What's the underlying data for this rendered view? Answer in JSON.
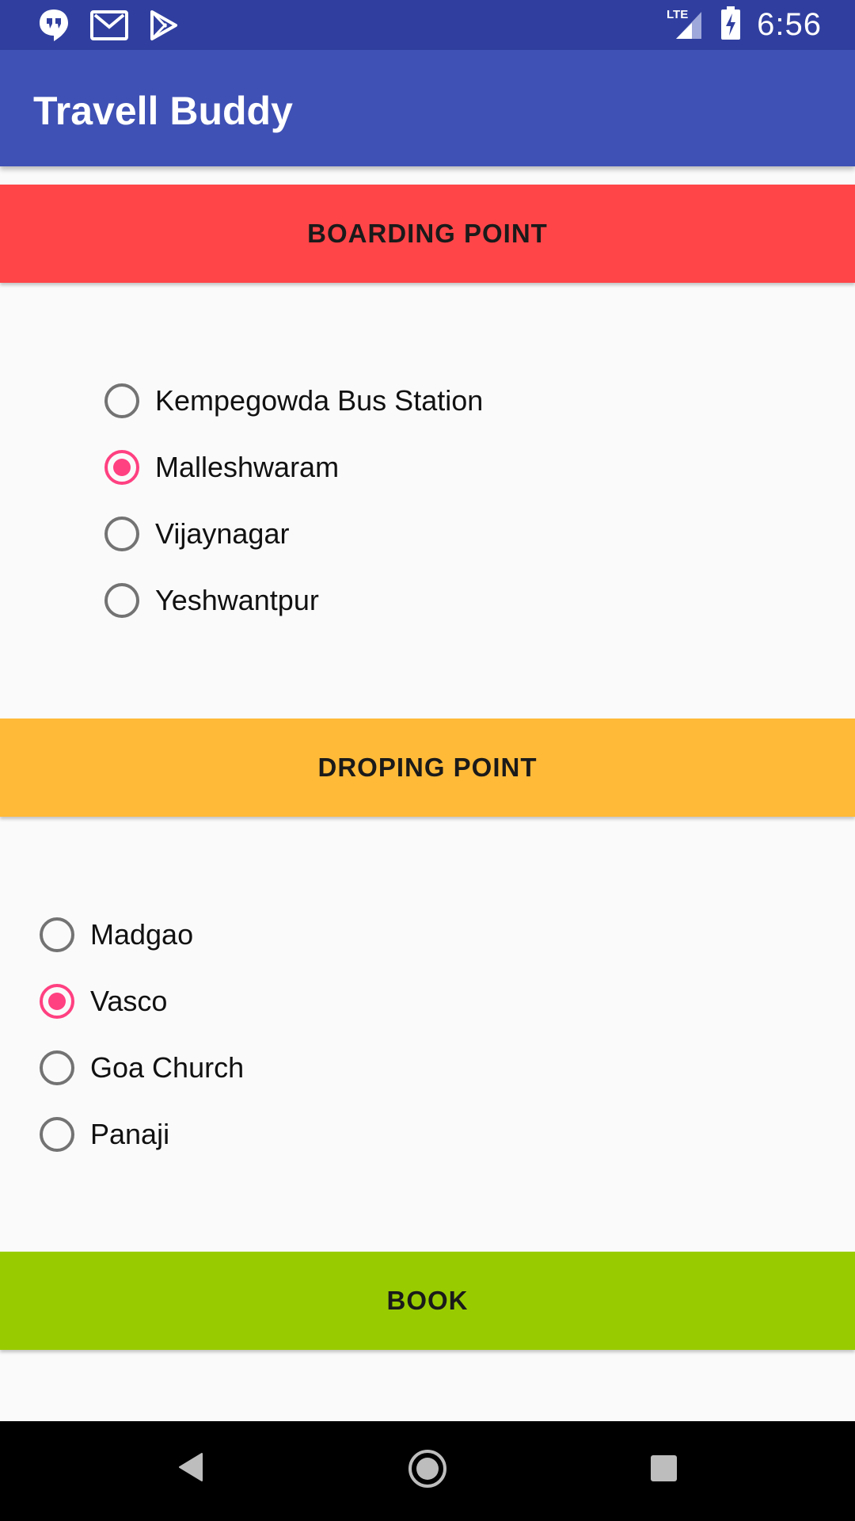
{
  "status_bar": {
    "time": "6:56",
    "network": "LTE",
    "left_icons": [
      "hangouts-icon",
      "gmail-icon",
      "play-store-icon"
    ]
  },
  "app_bar": {
    "title": "Travell Buddy"
  },
  "boarding": {
    "button_label": "BOARDING POINT",
    "options": [
      {
        "label": "Kempegowda Bus Station",
        "checked": false
      },
      {
        "label": "Malleshwaram",
        "checked": true
      },
      {
        "label": "Vijaynagar",
        "checked": false
      },
      {
        "label": "Yeshwantpur",
        "checked": false
      }
    ]
  },
  "droping": {
    "button_label": "DROPING POINT",
    "options": [
      {
        "label": "Madgao",
        "checked": false
      },
      {
        "label": "Vasco",
        "checked": true
      },
      {
        "label": "Goa Church",
        "checked": false
      },
      {
        "label": "Panaji",
        "checked": false
      }
    ]
  },
  "book": {
    "button_label": "BOOK"
  },
  "colors": {
    "status_bar": "#303f9f",
    "app_bar": "#3f51b5",
    "boarding_button": "#ff4548",
    "droping_button": "#ffba38",
    "book_button": "#99cc00",
    "radio_checked": "#ff4081",
    "radio_unchecked": "#737373"
  }
}
